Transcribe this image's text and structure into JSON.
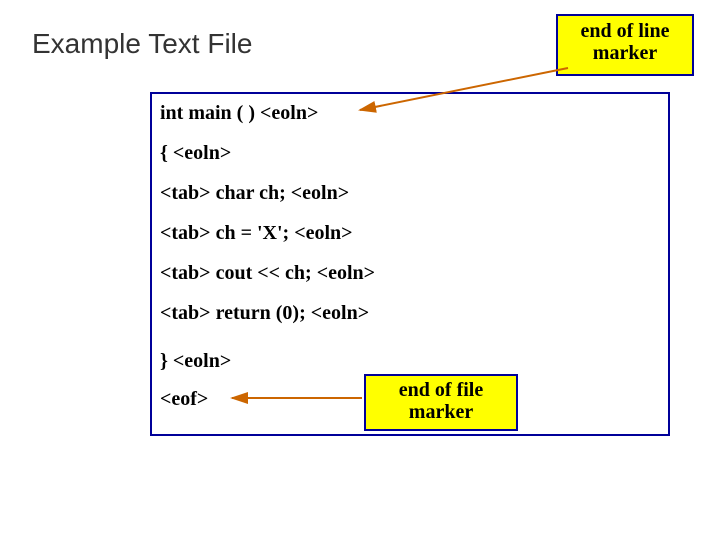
{
  "title": "Example Text File",
  "labels": {
    "eol_box_l1": "end of line",
    "eol_box_l2": "marker",
    "eof_box_l1": "end of file",
    "eof_box_l2": "marker"
  },
  "tokens": {
    "eoln": "<eoln>",
    "tab": "<tab>",
    "eof": "<eof>"
  },
  "code": {
    "l1_a": "int main ( )  ",
    "l2_a": "{ ",
    "l3_b": " char ch;  ",
    "l4_b": " ch = 'X';  ",
    "l5_b": " cout << ch;  ",
    "l6_b": " return (0);  ",
    "l7_a": "} "
  }
}
